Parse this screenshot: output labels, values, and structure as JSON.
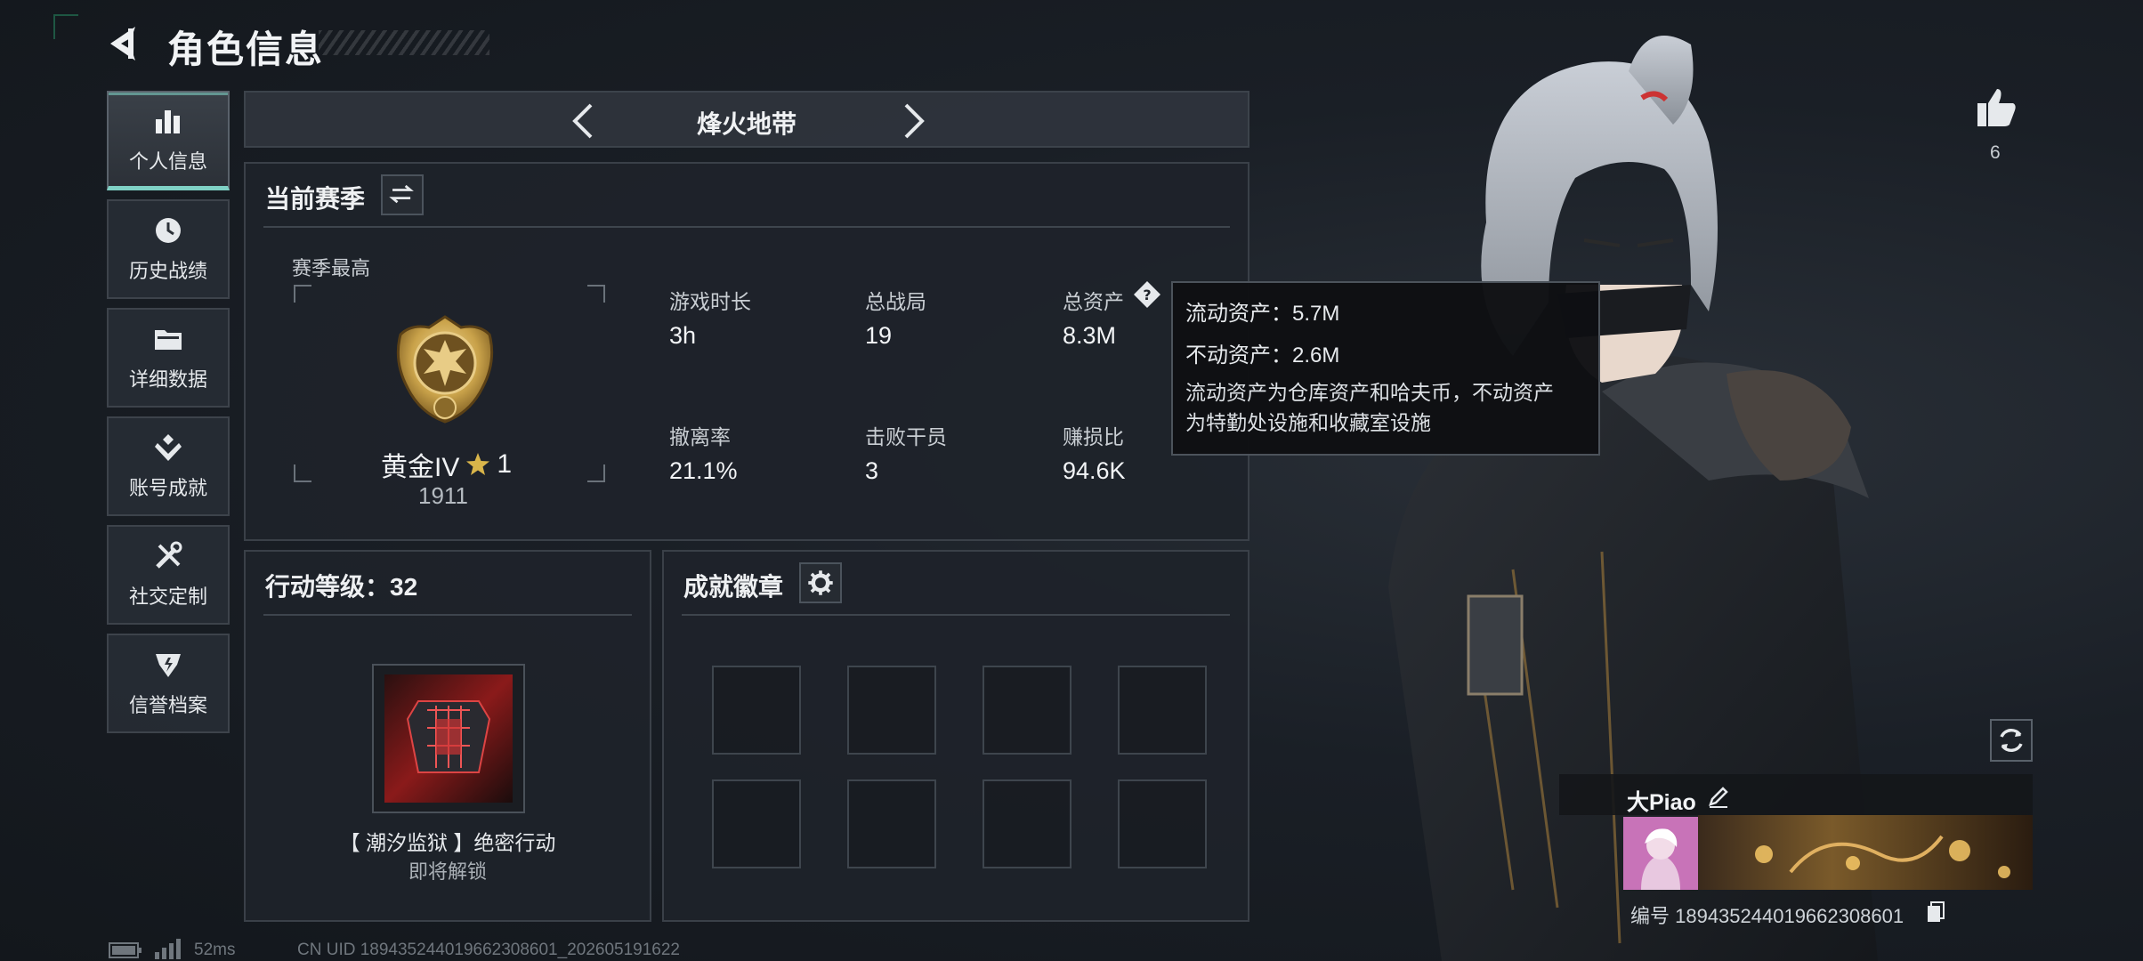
{
  "header": {
    "title": "角色信息"
  },
  "sidebar": {
    "items": [
      {
        "label": "个人信息",
        "icon": "bar-chart-icon",
        "active": true
      },
      {
        "label": "历史战绩",
        "icon": "clock-icon"
      },
      {
        "label": "详细数据",
        "icon": "folder-icon"
      },
      {
        "label": "账号成就",
        "icon": "achievement-icon"
      },
      {
        "label": "社交定制",
        "icon": "tools-icon"
      },
      {
        "label": "信誉档案",
        "icon": "shield-icon"
      }
    ]
  },
  "mode_bar": {
    "title": "烽火地带"
  },
  "season": {
    "title": "当前赛季",
    "peak_label": "赛季最高",
    "rank_name": "黄金IV",
    "rank_stars": "1",
    "rank_points": "1911",
    "stats": [
      {
        "label": "游戏时长",
        "value": "3h"
      },
      {
        "label": "总战局",
        "value": "19"
      },
      {
        "label": "总资产",
        "value": "8.3M"
      },
      {
        "label": "撤离率",
        "value": "21.1%"
      },
      {
        "label": "击败干员",
        "value": "3"
      },
      {
        "label": "赚损比",
        "value": "94.6K"
      }
    ]
  },
  "tooltip": {
    "liquid": "流动资产：5.7M",
    "fixed": "不动资产：2.6M",
    "description_line1": "流动资产为仓库资产和哈夫币，不动资产",
    "description_line2": "为特勤处设施和收藏室设施"
  },
  "level": {
    "title": "行动等级：32",
    "operation_name": "【 潮汐监狱 】绝密行动",
    "operation_status": "即将解锁"
  },
  "badges": {
    "title": "成就徽章",
    "slot_count": 8
  },
  "profile": {
    "likes": "6",
    "nickname": "大Piao",
    "id_text": "编号 189435244019662308601"
  },
  "footer": {
    "ping": "52ms",
    "uid": "CN UID 1894352440196623086​01_202605191622"
  },
  "colors": {
    "accent": "#7fd1c5",
    "gold": "#c9a24a",
    "panel": "#1e232a"
  }
}
